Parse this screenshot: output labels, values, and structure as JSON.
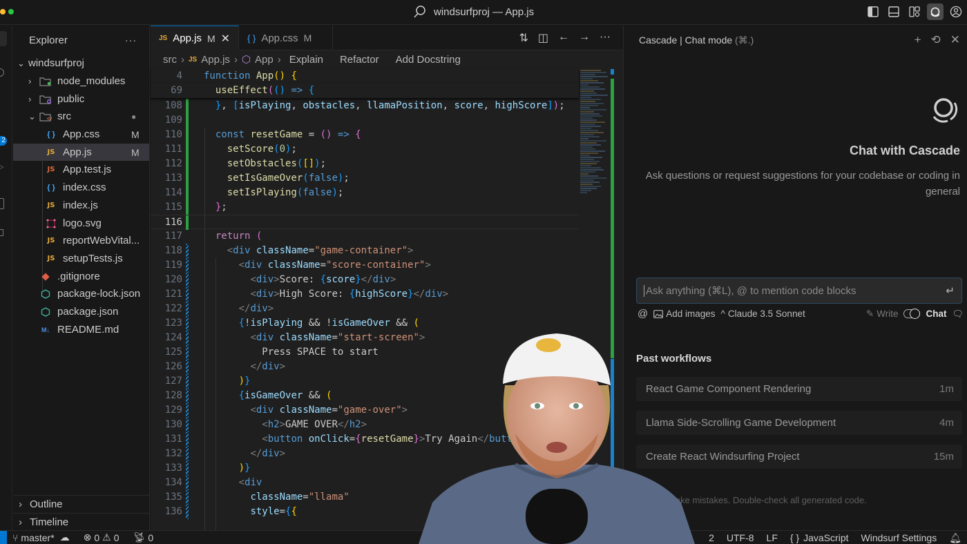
{
  "titlebar": {
    "title": "windsurfproj — App.js",
    "traffic_colors": [
      "#febc2e",
      "#28c840"
    ],
    "icons": [
      "toggle-primary-sidebar-icon",
      "toggle-panel-icon",
      "customize-layout-icon",
      "cascade-icon",
      "account-icon"
    ]
  },
  "activity_bar": {
    "source_control_badge": "2"
  },
  "explorer": {
    "title": "Explorer",
    "more_label": "···",
    "root": "windsurfproj",
    "items": [
      {
        "name": "node_modules",
        "type": "folder",
        "expanded": false,
        "dot": "#3fb950"
      },
      {
        "name": "public",
        "type": "folder",
        "expanded": false,
        "dot": "#a371f7"
      },
      {
        "name": "src",
        "type": "folder",
        "expanded": true,
        "status": "●"
      },
      {
        "name": "App.css",
        "type": "css",
        "status": "M"
      },
      {
        "name": "App.js",
        "type": "js",
        "status": "M",
        "selected": true
      },
      {
        "name": "App.test.js",
        "type": "js-test"
      },
      {
        "name": "index.css",
        "type": "css"
      },
      {
        "name": "index.js",
        "type": "js"
      },
      {
        "name": "logo.svg",
        "type": "svg"
      },
      {
        "name": "reportWebVital...",
        "type": "js"
      },
      {
        "name": "setupTests.js",
        "type": "js"
      },
      {
        "name": ".gitignore",
        "type": "git"
      },
      {
        "name": "package-lock.json",
        "type": "json"
      },
      {
        "name": "package.json",
        "type": "json"
      },
      {
        "name": "README.md",
        "type": "md"
      }
    ],
    "sections": [
      "Outline",
      "Timeline"
    ]
  },
  "editor": {
    "tabs": [
      {
        "icon": "JS",
        "label": "App.js",
        "status": "M",
        "active": true,
        "close": "✕"
      },
      {
        "icon": "{ }",
        "label": "App.css",
        "status": "M",
        "active": false
      }
    ],
    "breadcrumb": {
      "folder": "src",
      "file_icon": "JS",
      "file": "App.js",
      "symbol": "App",
      "lenses": [
        "Explain",
        "Refactor",
        "Add Docstring"
      ]
    },
    "sticky_lines": [
      {
        "n": "4",
        "html": "<span class='kw'>function</span> <span class='fn'>App</span><span class='br1'>()</span> <span class='br1'>{</span>"
      },
      {
        "n": "69",
        "html": "  <span class='fn'>useEffect</span><span class='br2'>(</span><span class='br3'>()</span> <span class='kw'>=&gt;</span> <span class='br3'>{</span>"
      }
    ],
    "lines": [
      {
        "n": "108",
        "html": "  <span class='br3'>}</span>, <span class='br3'>[</span><span class='var'>isPlaying</span>, <span class='var'>obstacles</span>, <span class='var'>llamaPosition</span>, <span class='var'>score</span>, <span class='var'>highScore</span><span class='br3'>]</span><span class='br2'>)</span>;"
      },
      {
        "n": "109",
        "html": ""
      },
      {
        "n": "110",
        "html": "  <span class='kw'>const</span> <span class='fn'>resetGame</span> = <span class='br2'>()</span> <span class='kw'>=&gt;</span> <span class='br2'>{</span>"
      },
      {
        "n": "111",
        "html": "    <span class='fn'>setScore</span><span class='br3'>(</span><span class='num'>0</span><span class='br3'>)</span>;"
      },
      {
        "n": "112",
        "html": "    <span class='fn'>setObstacles</span><span class='br3'>(</span><span class='br1'>[]</span><span class='br3'>)</span>;"
      },
      {
        "n": "113",
        "html": "    <span class='fn'>setIsGameOver</span><span class='br3'>(</span><span class='const'>false</span><span class='br3'>)</span>;"
      },
      {
        "n": "114",
        "html": "    <span class='fn'>setIsPlaying</span><span class='br3'>(</span><span class='const'>false</span><span class='br3'>)</span>;"
      },
      {
        "n": "115",
        "html": "  <span class='br2'>}</span>;"
      },
      {
        "n": "116",
        "html": "",
        "current": true
      },
      {
        "n": "117",
        "html": "  <span class='kw2'>return</span> <span class='br2'>(</span>"
      },
      {
        "n": "118",
        "html": "    <span class='punc'>&lt;</span><span class='tag'>div</span> <span class='var'>className</span>=<span class='str'>\"game-container\"</span><span class='punc'>&gt;</span>"
      },
      {
        "n": "119",
        "html": "      <span class='punc'>&lt;</span><span class='tag'>div</span> <span class='var'>className</span>=<span class='str'>\"score-container\"</span><span class='punc'>&gt;</span>"
      },
      {
        "n": "120",
        "html": "        <span class='punc'>&lt;</span><span class='tag'>div</span><span class='punc'>&gt;</span>Score: <span class='br3'>{</span><span class='var'>score</span><span class='br3'>}</span><span class='punc'>&lt;/</span><span class='tag'>div</span><span class='punc'>&gt;</span>"
      },
      {
        "n": "121",
        "html": "        <span class='punc'>&lt;</span><span class='tag'>div</span><span class='punc'>&gt;</span>High Score: <span class='br3'>{</span><span class='var'>highScore</span><span class='br3'>}</span><span class='punc'>&lt;/</span><span class='tag'>div</span><span class='punc'>&gt;</span>"
      },
      {
        "n": "122",
        "html": "      <span class='punc'>&lt;/</span><span class='tag'>div</span><span class='punc'>&gt;</span>"
      },
      {
        "n": "123",
        "html": "      <span class='br3'>{</span>!<span class='var'>isPlaying</span> &amp;&amp; !<span class='var'>isGameOver</span> &amp;&amp; <span class='br1'>(</span>"
      },
      {
        "n": "124",
        "html": "        <span class='punc'>&lt;</span><span class='tag'>div</span> <span class='var'>className</span>=<span class='str'>\"start-screen\"</span><span class='punc'>&gt;</span>"
      },
      {
        "n": "125",
        "html": "          Press SPACE to start"
      },
      {
        "n": "126",
        "html": "        <span class='punc'>&lt;/</span><span class='tag'>div</span><span class='punc'>&gt;</span>"
      },
      {
        "n": "127",
        "html": "      <span class='br1'>)</span><span class='br3'>}</span>"
      },
      {
        "n": "128",
        "html": "      <span class='br3'>{</span><span class='var'>isGameOver</span> &amp;&amp; <span class='br1'>(</span>"
      },
      {
        "n": "129",
        "html": "        <span class='punc'>&lt;</span><span class='tag'>div</span> <span class='var'>className</span>=<span class='str'>\"game-over\"</span><span class='punc'>&gt;</span>"
      },
      {
        "n": "130",
        "html": "          <span class='punc'>&lt;</span><span class='tag'>h2</span><span class='punc'>&gt;</span>GAME OVER<span class='punc'>&lt;/</span><span class='tag'>h2</span><span class='punc'>&gt;</span>"
      },
      {
        "n": "131",
        "html": "          <span class='punc'>&lt;</span><span class='tag'>button</span> <span class='var'>onClick</span>=<span class='br2'>{</span><span class='fn'>resetGame</span><span class='br2'>}</span><span class='punc'>&gt;</span>Try Again<span class='punc'>&lt;/</span><span class='tag'>butt</span>"
      },
      {
        "n": "132",
        "html": "        <span class='punc'>&lt;/</span><span class='tag'>div</span><span class='punc'>&gt;</span>"
      },
      {
        "n": "133",
        "html": "      <span class='br1'>)</span><span class='br3'>}</span>"
      },
      {
        "n": "134",
        "html": "      <span class='punc'>&lt;</span><span class='tag'>div</span>"
      },
      {
        "n": "135",
        "html": "        <span class='var'>className</span>=<span class='str'>\"llama\"</span>"
      },
      {
        "n": "136",
        "html": "        <span class='var'>style</span>=<span class='br3'>{</span><span class='br1'>{</span>"
      }
    ]
  },
  "cascade": {
    "header_title": "Cascade | Chat mode",
    "header_shortcut": "(⌘.)",
    "header_icons": {
      "new": "+",
      "history": "⟲",
      "close": "✕"
    },
    "welcome_title": "Chat with Cascade",
    "welcome_subtitle": "Ask questions or request suggestions for your codebase or coding in general",
    "input_placeholder": "Ask anything (⌘L), @ to mention code blocks",
    "input_value": "",
    "tools": {
      "mention": "@",
      "add_images": "Add images",
      "model": "Claude 3.5 Sonnet",
      "write": "Write",
      "chat": "Chat"
    },
    "past_workflows_title": "Past workflows",
    "workflows": [
      {
        "title": "React Game Component Rendering",
        "age": "1m"
      },
      {
        "title": "Llama Side-Scrolling Game Development",
        "age": "4m"
      },
      {
        "title": "Create React Windsurfing Project",
        "age": "15m"
      }
    ],
    "disclaimer": "AI may make mistakes. Double-check all generated code."
  },
  "statusbar": {
    "branch": "master*",
    "errors": "0",
    "warnings": "0",
    "ports": "0",
    "indent_tail": "2",
    "encoding": "UTF-8",
    "eol": "LF",
    "language": "JavaScript",
    "settings": "Windsurf Settings"
  },
  "webcam": {
    "description": "presenter webcam overlay"
  }
}
